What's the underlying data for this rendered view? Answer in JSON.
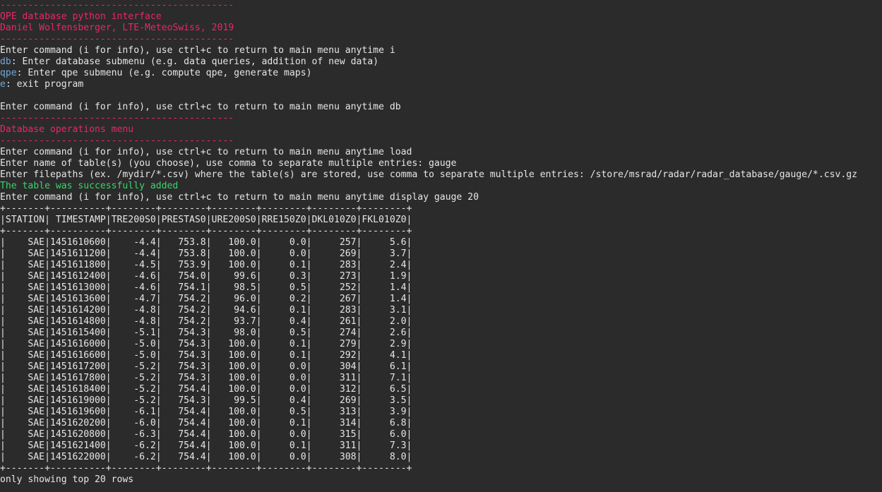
{
  "colors": {
    "background": "#2b2b2b",
    "text": "#e6e6e6",
    "header_pink": "#e8276b",
    "keyword_blue": "#6fa8dc",
    "success_green": "#38d66b"
  },
  "header": {
    "sep": "------------------------------------------",
    "title": "QPE database python interface",
    "author": "Daniel Wolfensberger, LTE-MeteoSwiss, 2019"
  },
  "main_menu": {
    "prompt1": "Enter command (i for info), use ctrl+c to return to main menu anytime i",
    "db_key": "db",
    "db_desc": ": Enter database submenu (e.g. data queries, addition of new data)",
    "qpe_key": "qpe",
    "qpe_desc": ": Enter qpe submenu (e.g. compute qpe, generate maps)",
    "e_key": "e",
    "e_desc": ": exit program",
    "prompt2": "Enter command (i for info), use ctrl+c to return to main menu anytime db"
  },
  "db_menu": {
    "sep": "------------------------------------------",
    "title": "Database operations menu",
    "prompt_load": "Enter command (i for info), use ctrl+c to return to main menu anytime load",
    "prompt_name": "Enter name of table(s) (you choose), use comma to separate multiple entries: gauge",
    "prompt_path": "Enter filepaths (ex. /mydir/*.csv) where the table(s) are stored, use comma to separate multiple entries: /store/msrad/radar/radar_database/gauge/*.csv.gz",
    "success": "The table was successfully added",
    "prompt_display": "Enter command (i for info), use ctrl+c to return to main menu anytime display gauge 20"
  },
  "table": {
    "border": "+-------+----------+--------+--------+--------+--------+--------+--------+",
    "header": "|STATION| TIMESTAMP|TRE200S0|PRESTAS0|URE200S0|RRE150Z0|DKL010Z0|FKL010Z0|",
    "rows": [
      "|    SAE|1451610600|    -4.4|   753.8|   100.0|     0.0|     257|     5.6|",
      "|    SAE|1451611200|    -4.4|   753.8|   100.0|     0.0|     269|     3.7|",
      "|    SAE|1451611800|    -4.5|   753.9|   100.0|     0.1|     283|     2.4|",
      "|    SAE|1451612400|    -4.6|   754.0|    99.6|     0.3|     273|     1.9|",
      "|    SAE|1451613000|    -4.6|   754.1|    98.5|     0.5|     252|     1.4|",
      "|    SAE|1451613600|    -4.7|   754.2|    96.0|     0.2|     267|     1.4|",
      "|    SAE|1451614200|    -4.8|   754.2|    94.6|     0.1|     283|     3.1|",
      "|    SAE|1451614800|    -4.8|   754.2|    93.7|     0.4|     261|     2.0|",
      "|    SAE|1451615400|    -5.1|   754.3|    98.0|     0.5|     274|     2.6|",
      "|    SAE|1451616000|    -5.0|   754.3|   100.0|     0.1|     279|     2.9|",
      "|    SAE|1451616600|    -5.0|   754.3|   100.0|     0.1|     292|     4.1|",
      "|    SAE|1451617200|    -5.2|   754.3|   100.0|     0.0|     304|     6.1|",
      "|    SAE|1451617800|    -5.2|   754.3|   100.0|     0.0|     311|     7.1|",
      "|    SAE|1451618400|    -5.2|   754.4|   100.0|     0.0|     312|     6.5|",
      "|    SAE|1451619000|    -5.2|   754.3|    99.5|     0.4|     269|     3.5|",
      "|    SAE|1451619600|    -6.1|   754.4|   100.0|     0.5|     313|     3.9|",
      "|    SAE|1451620200|    -6.0|   754.4|   100.0|     0.1|     314|     6.8|",
      "|    SAE|1451620800|    -6.3|   754.4|   100.0|     0.0|     315|     6.0|",
      "|    SAE|1451621400|    -6.2|   754.4|   100.0|     0.1|     311|     7.3|",
      "|    SAE|1451622000|    -6.2|   754.4|   100.0|     0.0|     308|     8.0|"
    ],
    "footer": "only showing top 20 rows"
  }
}
